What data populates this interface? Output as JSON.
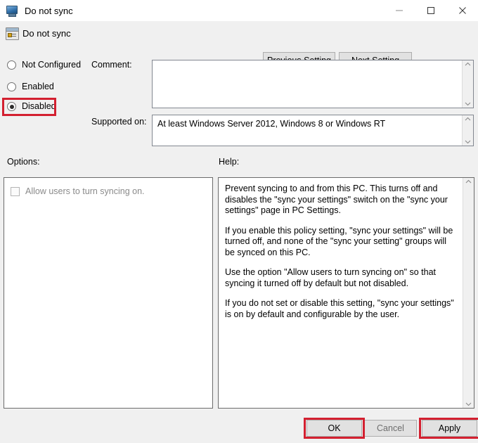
{
  "window": {
    "title": "Do not sync",
    "icon": "computer-monitor-icon",
    "controls": {
      "minimize": "minimize-icon",
      "maximize": "maximize-icon",
      "close": "close-icon"
    }
  },
  "header": {
    "title": "Do not sync",
    "icon": "policy-setting-icon",
    "previous_setting_label": "Previous Setting",
    "next_setting_label": "Next Setting"
  },
  "state_options": [
    {
      "label": "Not Configured",
      "selected": false
    },
    {
      "label": "Enabled",
      "selected": false
    },
    {
      "label": "Disabled",
      "selected": true
    }
  ],
  "fields": {
    "comment_label": "Comment:",
    "comment_value": "",
    "supported_label": "Supported on:",
    "supported_value": "At least Windows Server 2012, Windows 8 or Windows RT"
  },
  "options": {
    "label": "Options:",
    "checkbox_label": "Allow users to turn syncing on.",
    "checkbox_checked": false,
    "checkbox_enabled": false
  },
  "help": {
    "label": "Help:",
    "paragraphs": [
      "Prevent syncing to and from this PC.  This turns off and disables the \"sync your settings\" switch on the \"sync your settings\" page in PC Settings.",
      "If you enable this policy setting, \"sync your settings\" will be turned off, and none of the \"sync your setting\" groups will be synced on this PC.",
      "Use the option \"Allow users to turn syncing on\" so that syncing it turned off by default but not disabled.",
      "If you do not set or disable this setting, \"sync your settings\" is on by default and configurable by the user."
    ]
  },
  "footer": {
    "ok_label": "OK",
    "cancel_label": "Cancel",
    "apply_label": "Apply"
  },
  "annotations": {
    "highlight_color": "#d32030",
    "highlighted": [
      "Disabled",
      "OK",
      "Apply"
    ]
  }
}
